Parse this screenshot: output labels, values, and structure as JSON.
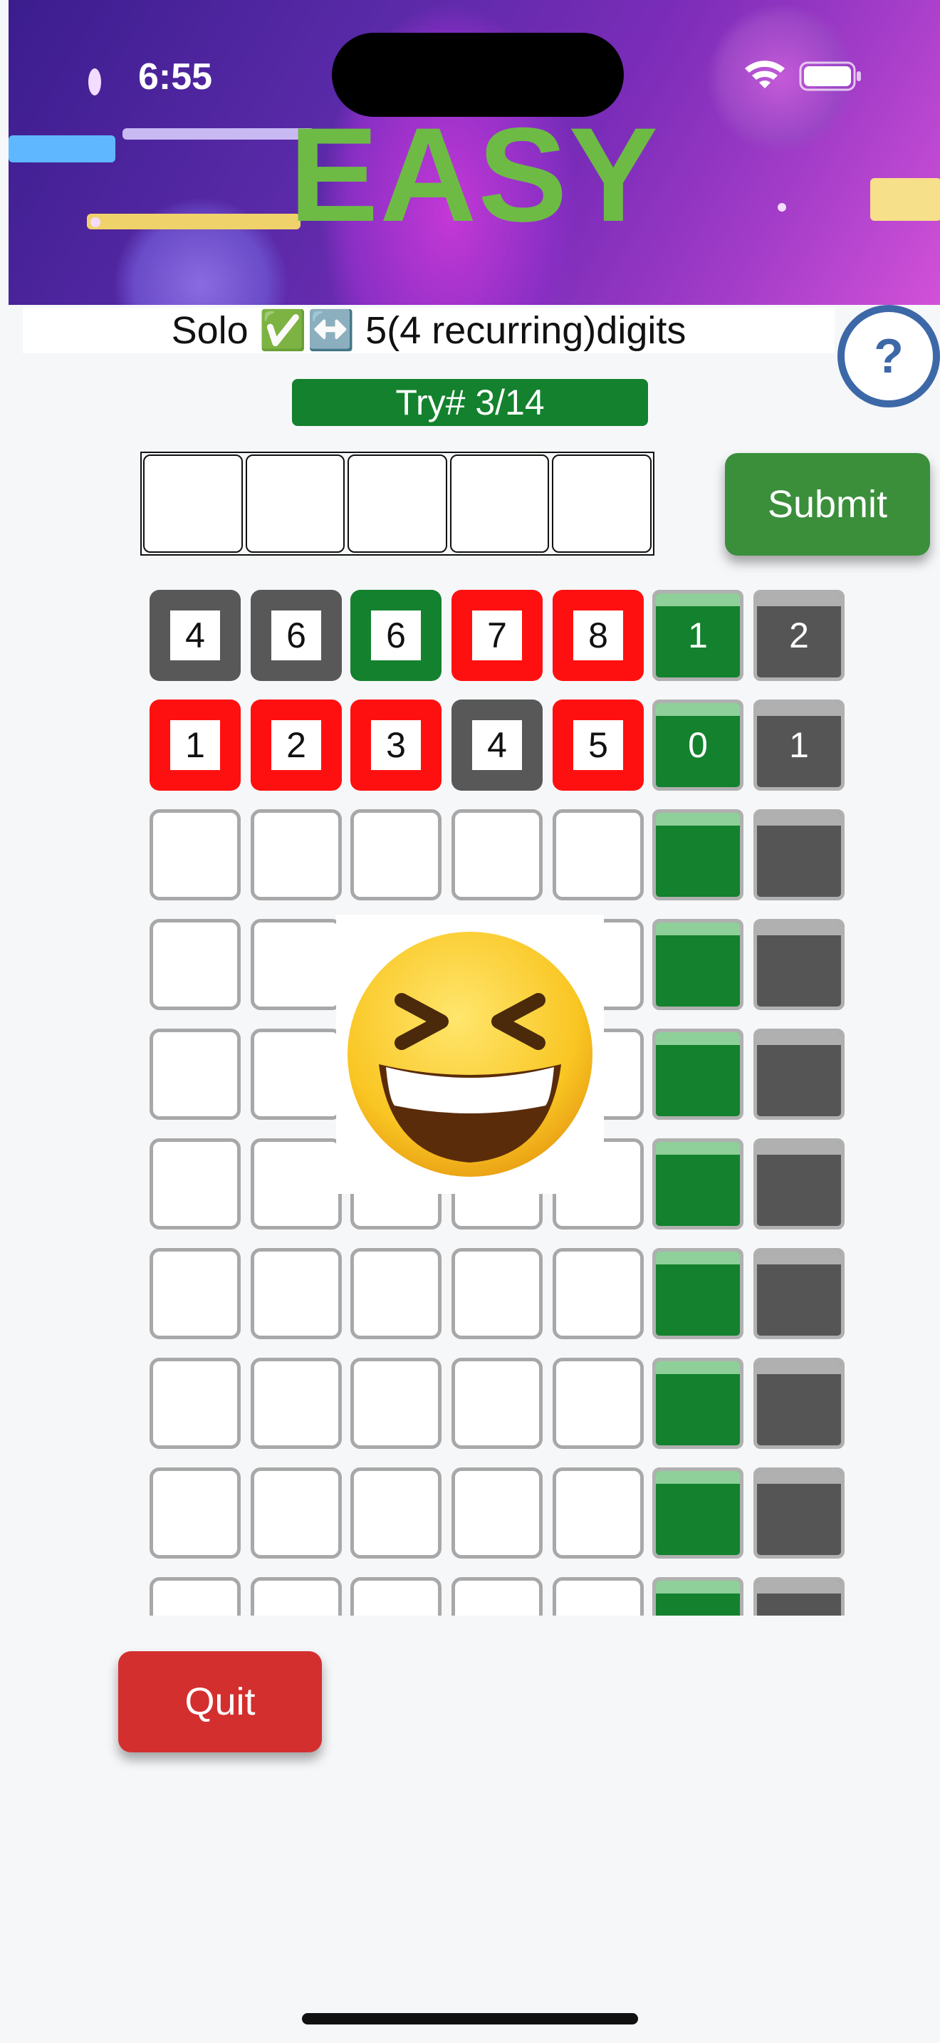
{
  "status_bar": {
    "time": "6:55",
    "icons": [
      "wifi-icon",
      "battery-icon"
    ]
  },
  "banner": {
    "title": "EASY",
    "title_color": "#6dbb45"
  },
  "subtitle": {
    "text": "Solo ✅↔️ 5(4 recurring)digits"
  },
  "help": {
    "label": "?",
    "icon": "help-icon"
  },
  "try": {
    "label": "Try# 3/14"
  },
  "submit": {
    "label": "Submit"
  },
  "quit": {
    "label": "Quit"
  },
  "colors": {
    "correct_place": "#13812d",
    "not_in_number": "#ff1010",
    "in_number_wrong_place": "#585858",
    "quit": "#d32f2f",
    "submit": "#3b8f3b"
  },
  "guesses": [
    {
      "digits": [
        {
          "value": "4",
          "state": "grey"
        },
        {
          "value": "6",
          "state": "grey"
        },
        {
          "value": "6",
          "state": "green"
        },
        {
          "value": "7",
          "state": "red"
        },
        {
          "value": "8",
          "state": "red"
        }
      ],
      "correct_count": "1",
      "misplaced_count": "2"
    },
    {
      "digits": [
        {
          "value": "1",
          "state": "red"
        },
        {
          "value": "2",
          "state": "red"
        },
        {
          "value": "3",
          "state": "red"
        },
        {
          "value": "4",
          "state": "grey"
        },
        {
          "value": "5",
          "state": "red"
        }
      ],
      "correct_count": "0",
      "misplaced_count": "1"
    }
  ],
  "total_rows_visible": 10,
  "overlay": {
    "emoji": "😆",
    "icon": "grinning-squinting-face-icon"
  }
}
